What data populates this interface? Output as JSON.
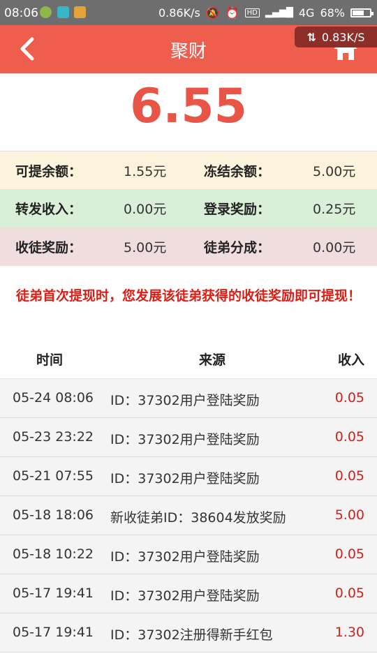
{
  "status_bar": {
    "time": "08:06",
    "net_speed": "0.86K/s",
    "hd": "HD",
    "network": "4G",
    "battery": "68%",
    "battery_level": 0.68
  },
  "header": {
    "title": "聚财",
    "speed_overlay": "0.83K/S"
  },
  "total": "6.55",
  "stats": [
    {
      "l1": "可提余额：",
      "v1": "1.55元",
      "l2": "冻结余额：",
      "v2": "5.00元"
    },
    {
      "l1": "转发收入：",
      "v1": "0.00元",
      "l2": "登录奖励：",
      "v2": "0.25元"
    },
    {
      "l1": "收徒奖励：",
      "v1": "5.00元",
      "l2": "徒弟分成：",
      "v2": "0.00元"
    }
  ],
  "notice": "徒弟首次提现时，您发展该徒弟获得的收徒奖励即可提现！",
  "table": {
    "headers": {
      "time": "时间",
      "source": "来源",
      "income": "收入"
    },
    "rows": [
      {
        "time": "05-24 08:06",
        "source": "ID：37302用户登陆奖励",
        "amount": "0.05"
      },
      {
        "time": "05-23 23:22",
        "source": "ID：37302用户登陆奖励",
        "amount": "0.05"
      },
      {
        "time": "05-21 07:55",
        "source": "ID：37302用户登陆奖励",
        "amount": "0.05"
      },
      {
        "time": "05-18 18:06",
        "source": "新收徒弟ID：38604发放奖励",
        "amount": "5.00"
      },
      {
        "time": "05-18 10:22",
        "source": "ID：37302用户登陆奖励",
        "amount": "0.05"
      },
      {
        "time": "05-17 19:41",
        "source": "ID：37302用户登陆奖励",
        "amount": "0.05"
      },
      {
        "time": "05-17 19:41",
        "source": "ID：37302注册得新手红包",
        "amount": "1.30"
      }
    ]
  },
  "colors": {
    "header": "#ef5d4d",
    "accent_red": "#e85547",
    "income_red": "#d2201a"
  },
  "icons": [
    "back-arrow-icon",
    "home-icon",
    "sync-arrows-icon"
  ]
}
